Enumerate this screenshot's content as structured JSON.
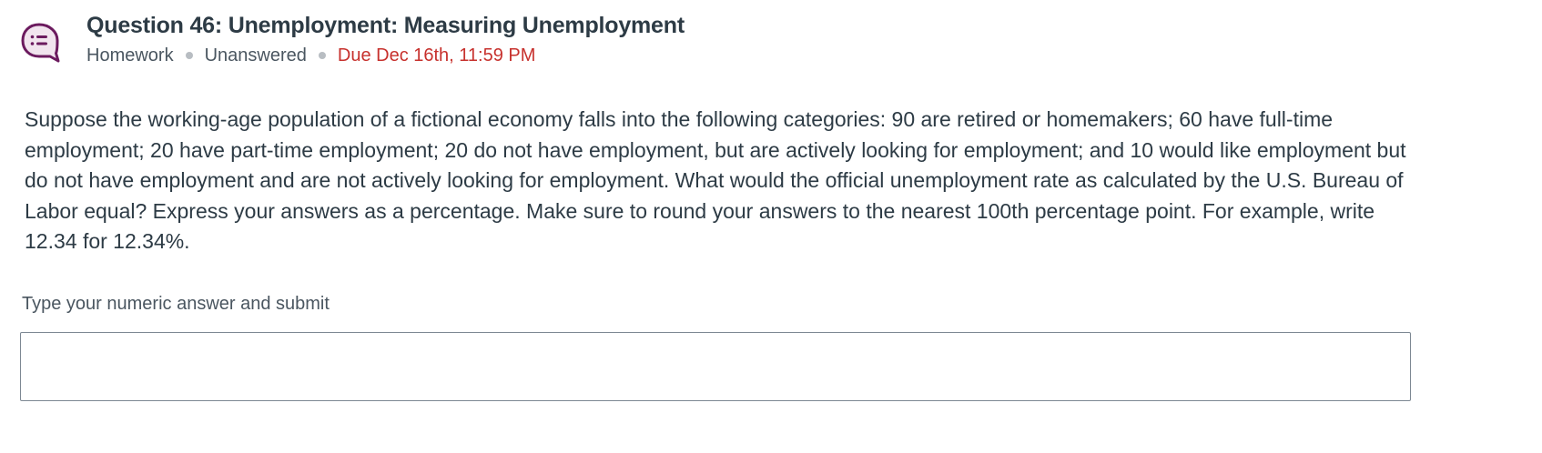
{
  "question": {
    "title": "Question 46: Unemployment: Measuring Unemployment",
    "meta": {
      "type": "Homework",
      "status": "Unanswered",
      "due": "Due Dec 16th, 11:59 PM"
    },
    "icon": "question-list-chat-icon",
    "prompt": "Suppose the working-age population of a fictional economy falls into the following categories: 90 are retired or homemakers; 60 have full-time employment; 20 have part-time employment; 20 do not have employment, but are actively looking for employment; and 10 would like employment but do not have employment and are not actively looking for employment. What would the official unemployment rate as calculated by the U.S. Bureau of Labor equal? Express your answers as a percentage. Make sure to round your answers to the nearest 100th percentage point. For example, write 12.34 for 12.34%."
  },
  "answer": {
    "label": "Type your numeric answer and submit",
    "value": ""
  },
  "colors": {
    "icon_accent": "#6b1a5e",
    "icon_fill": "#f1e4ee",
    "due_red": "#c7312d",
    "text_dark": "#2d3b45",
    "meta_dot": "#b8bdc2",
    "input_border": "#7d8893"
  }
}
